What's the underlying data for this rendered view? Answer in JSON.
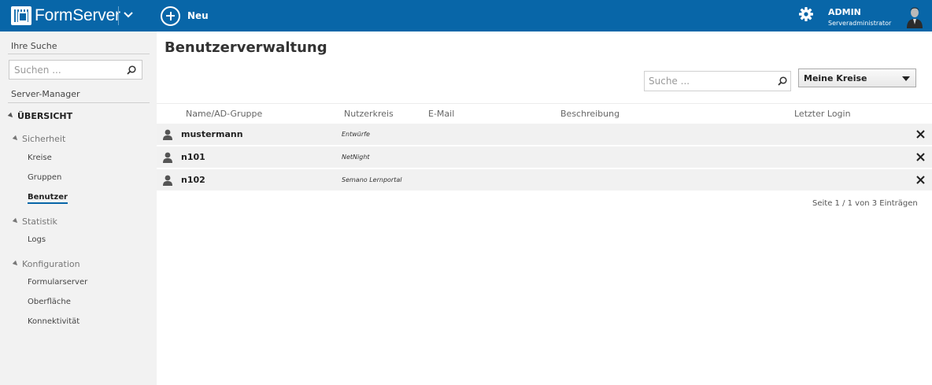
{
  "app": {
    "logo_text": "FormServer",
    "new_label": "Neu",
    "user_name": "ADMIN",
    "user_role": "Serveradministrator"
  },
  "sidebar": {
    "search_heading": "Ihre Suche",
    "search_placeholder": "Suchen ...",
    "manager_heading": "Server-Manager",
    "overview_label": "ÜBERSICHT",
    "groups": [
      {
        "label": "Sicherheit",
        "items": [
          "Kreise",
          "Gruppen",
          "Benutzer"
        ]
      },
      {
        "label": "Statistik",
        "items": [
          "Logs"
        ]
      },
      {
        "label": "Konfiguration",
        "items": [
          "Formularserver",
          "Oberfläche",
          "Konnektivität"
        ]
      }
    ],
    "active_item": "Benutzer"
  },
  "main": {
    "title": "Benutzerverwaltung",
    "search_placeholder": "Suche ...",
    "filter_value": "Meine Kreise",
    "columns": [
      "Name/AD-Gruppe",
      "Nutzerkreis",
      "E-Mail",
      "Beschreibung",
      "Letzter Login"
    ],
    "rows": [
      {
        "name": "mustermann",
        "circle": "Entwürfe",
        "email": "",
        "description": "",
        "last_login": ""
      },
      {
        "name": "n101",
        "circle": "NetNight",
        "email": "",
        "description": "",
        "last_login": ""
      },
      {
        "name": "n102",
        "circle": "Semano Lernportal",
        "email": "",
        "description": "",
        "last_login": ""
      }
    ],
    "pager": "Seite 1 / 1 von 3 Einträgen"
  },
  "colors": {
    "topbar": "#0866a8",
    "sidebar_bg": "#f2f2f2",
    "row_bg": "#f1f1f1"
  }
}
